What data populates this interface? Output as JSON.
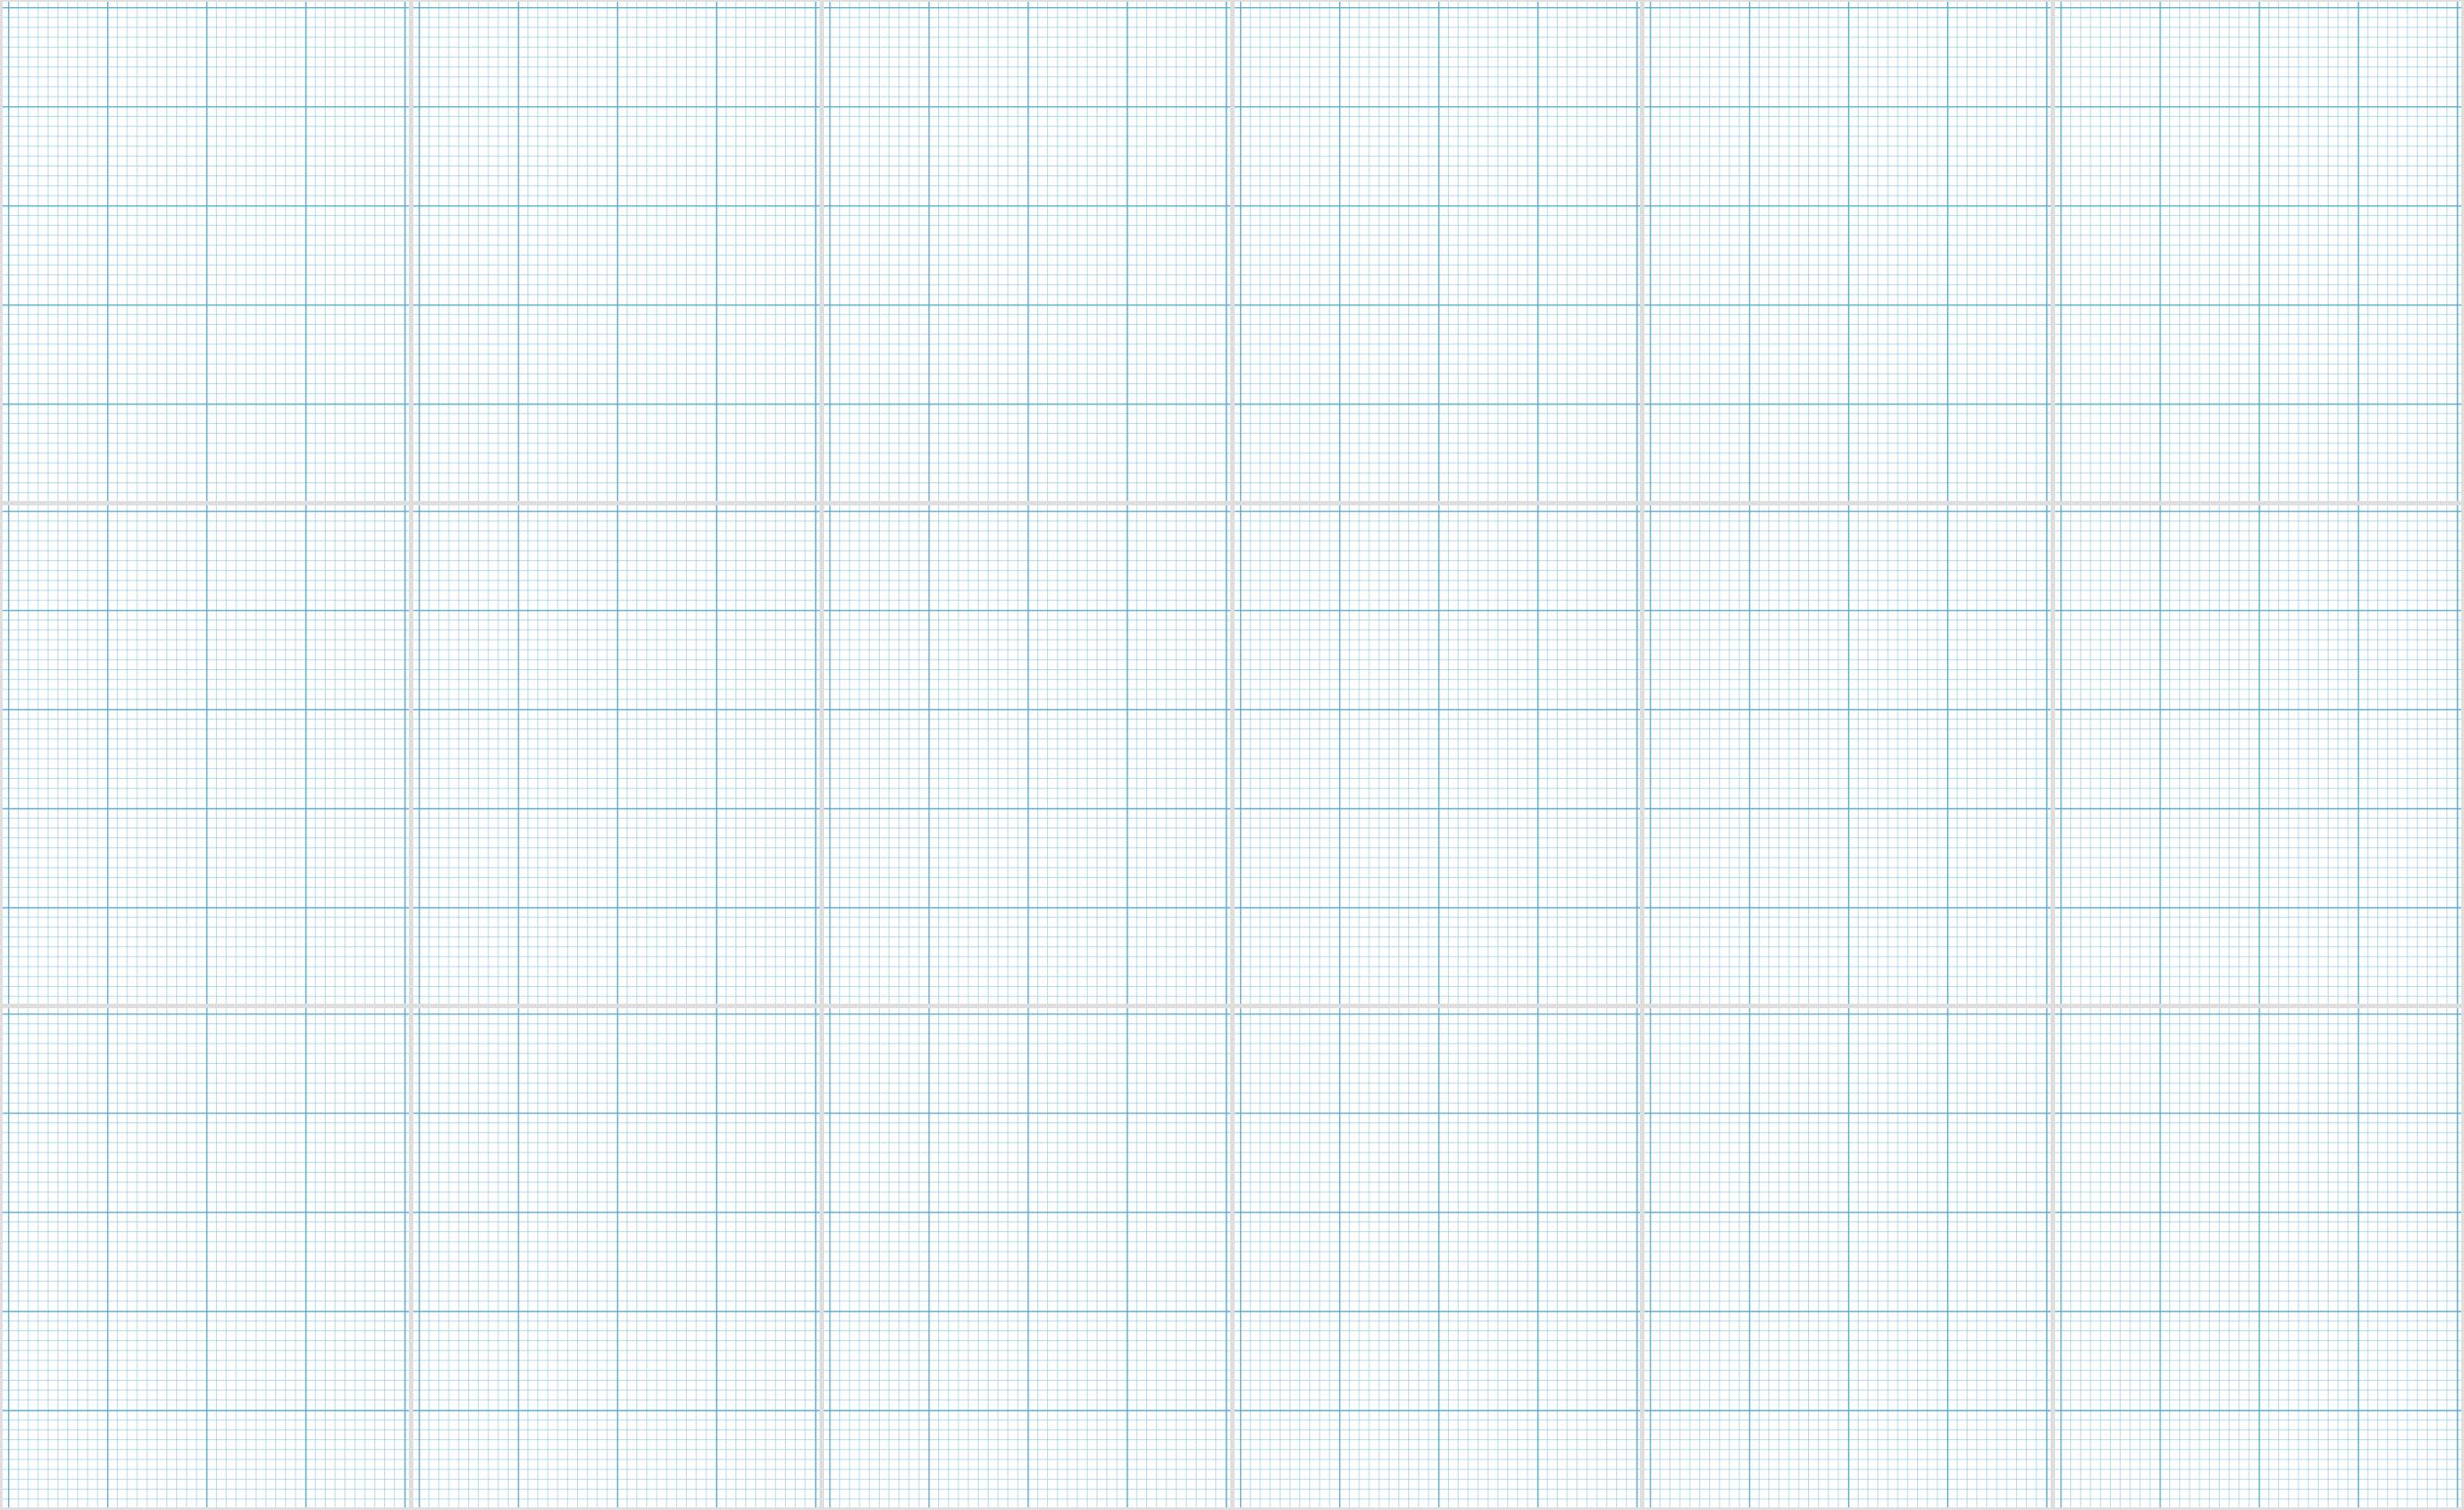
{
  "page": {
    "description_colors": {
      "background": "#dedede",
      "sheet": "#ffffff",
      "major_line": "#5aaacd",
      "minor_line": "#96cde4"
    }
  },
  "sheets": [
    {},
    {},
    {},
    {},
    {},
    {},
    {},
    {},
    {},
    {},
    {},
    {},
    {},
    {},
    {},
    {},
    {},
    {}
  ]
}
